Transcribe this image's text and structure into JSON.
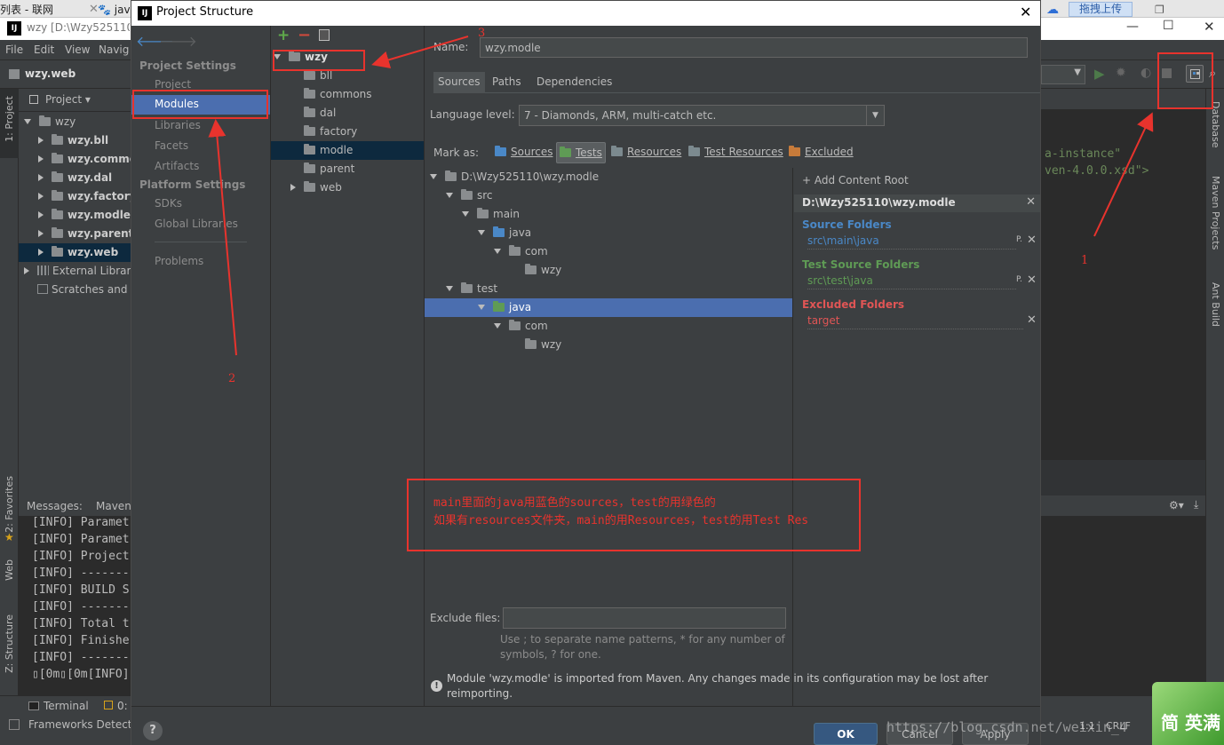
{
  "browser_tabs": [
    "列表 - 联网",
    "java",
    "拖拽上传"
  ],
  "ide": {
    "window_title": "wzy [D:\\Wzy525110]",
    "menu": [
      "File",
      "Edit",
      "View",
      "Navig"
    ],
    "nav_project": "wzy.web",
    "project_tab": "Project",
    "tree": [
      {
        "label": "wzy",
        "depth": 0,
        "bold": false
      },
      {
        "label": "wzy.bll",
        "depth": 1,
        "bold": true
      },
      {
        "label": "wzy.commo",
        "depth": 1,
        "bold": true
      },
      {
        "label": "wzy.dal",
        "depth": 1,
        "bold": true
      },
      {
        "label": "wzy.factory",
        "depth": 1,
        "bold": true
      },
      {
        "label": "wzy.modle",
        "depth": 1,
        "bold": true
      },
      {
        "label": "wzy.parent",
        "depth": 1,
        "bold": true
      },
      {
        "label": "wzy.web",
        "depth": 1,
        "bold": true
      },
      {
        "label": "External Librari",
        "depth": 0,
        "bold": false
      },
      {
        "label": "Scratches and",
        "depth": 0,
        "bold": false
      }
    ],
    "left_tool_tabs": [
      "1: Project",
      "2: Favorites",
      "Web",
      "Z: Structure"
    ],
    "right_tool_tabs": [
      "Database",
      "Maven Projects",
      "Ant Build"
    ],
    "messages_tabs": [
      "Messages:",
      "Maven"
    ],
    "log_lines": [
      "[INFO] Paramet",
      "[INFO] Paramet",
      "[INFO] Project",
      "[INFO] -------",
      "[INFO] BUILD S",
      "[INFO] -------",
      "[INFO] Total t",
      "[INFO] Finishe",
      "[INFO] -------",
      "▯[0m▯[0m[INFO]"
    ],
    "editor_snippets": [
      "a-instance\"",
      "ven-4.0.0.xsd\">"
    ],
    "bottom_tabs": [
      "Terminal",
      "0:"
    ],
    "status_text": "Frameworks Detect",
    "status_right": [
      "1:1",
      "CRLF"
    ]
  },
  "dialog": {
    "title": "Project Structure",
    "sidebar": {
      "project_settings_header": "Project Settings",
      "project_settings": [
        "Project",
        "Modules",
        "Libraries",
        "Facets",
        "Artifacts"
      ],
      "platform_settings_header": "Platform Settings",
      "platform_settings": [
        "SDKs",
        "Global Libraries"
      ],
      "problems": "Problems",
      "selected": "Modules"
    },
    "module_tree": {
      "root": "wzy",
      "children": [
        "bll",
        "commons",
        "dal",
        "factory",
        "modle",
        "parent",
        "web"
      ],
      "selected": "modle"
    },
    "name_label": "Name:",
    "name_value": "wzy.modle",
    "tabs": [
      "Sources",
      "Paths",
      "Dependencies"
    ],
    "active_tab": "Sources",
    "language_level_label": "Language level:",
    "language_level_value": "7 - Diamonds, ARM, multi-catch etc.",
    "mark_as_label": "Mark as:",
    "mark_as": [
      {
        "label": "Sources",
        "color": "#4a88c7"
      },
      {
        "label": "Tests",
        "color": "#5f9b55"
      },
      {
        "label": "Resources",
        "color": "#7c8a8f"
      },
      {
        "label": "Test Resources",
        "color": "#7c8a8f"
      },
      {
        "label": "Excluded",
        "color": "#c77b3a"
      }
    ],
    "content_tree": [
      {
        "label": "D:\\Wzy525110\\wzy.modle",
        "depth": 0,
        "color": "#8a8d8f",
        "expanded": true
      },
      {
        "label": "src",
        "depth": 1,
        "color": "#8a8d8f",
        "expanded": true
      },
      {
        "label": "main",
        "depth": 2,
        "color": "#8a8d8f",
        "expanded": true
      },
      {
        "label": "java",
        "depth": 3,
        "color": "#4a88c7",
        "expanded": true
      },
      {
        "label": "com",
        "depth": 4,
        "color": "#8a8d8f",
        "expanded": true
      },
      {
        "label": "wzy",
        "depth": 5,
        "color": "#8a8d8f",
        "expanded": false
      },
      {
        "label": "test",
        "depth": 1,
        "color": "#8a8d8f",
        "expanded": true
      },
      {
        "label": "java",
        "depth": 2,
        "color": "#5f9b55",
        "expanded": true,
        "selected": true
      },
      {
        "label": "com",
        "depth": 4,
        "color": "#8a8d8f",
        "expanded": true
      },
      {
        "label": "wzy",
        "depth": 5,
        "color": "#8a8d8f",
        "expanded": false
      }
    ],
    "add_content_root": "+ Add Content Root",
    "root_path": "D:\\Wzy525110\\wzy.modle",
    "source_folders_label": "Source Folders",
    "source_folders": [
      "src\\main\\java"
    ],
    "test_source_folders_label": "Test Source Folders",
    "test_source_folders": [
      "src\\test\\java"
    ],
    "excluded_folders_label": "Excluded Folders",
    "excluded_folders": [
      "target"
    ],
    "exclude_files_label": "Exclude files:",
    "exclude_files_value": "",
    "exclude_hint_1": "Use ; to separate name patterns, * for any number of",
    "exclude_hint_2": "symbols, ? for one.",
    "maven_warning_1": "Module 'wzy.modle' is imported from Maven. Any changes made in its configuration may be lost after",
    "maven_warning_2": "reimporting.",
    "ok": "OK",
    "cancel": "Cancel",
    "apply": "Apply",
    "help": "?"
  },
  "annotations": {
    "note_line1": "main里面的java用蓝色的sources，test的用绿色的",
    "note_line2": "如果有resources文件夹，main的用Resources，test的用Test Res",
    "labels": [
      "1",
      "2",
      "3"
    ],
    "color": "#e8332d"
  },
  "watermark": "https://blog.csdn.net/weixin_4",
  "corner_badge": "简 英满"
}
